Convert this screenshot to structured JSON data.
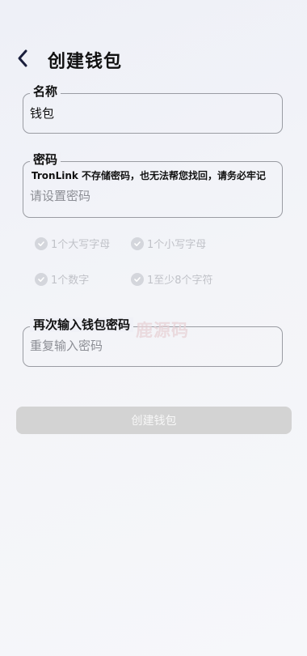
{
  "header": {
    "back_icon": "chevron-left-icon",
    "title": "创建钱包"
  },
  "wallet_name": {
    "label": "名称",
    "value": "钱包"
  },
  "password": {
    "label": "密码",
    "hint": "TronLink 不存储密码，也无法帮您找回，请务必牢记",
    "placeholder": "请设置密码"
  },
  "rules": [
    {
      "label": "1个大写字母",
      "icon": "check-circle-icon"
    },
    {
      "label": "1个小写字母",
      "icon": "check-circle-icon"
    },
    {
      "label": "1个数字",
      "icon": "check-circle-icon"
    },
    {
      "label": "1至少8个字符",
      "icon": "check-circle-icon"
    }
  ],
  "confirm_password": {
    "label": "再次输入钱包密码",
    "placeholder": "重复输入密码"
  },
  "watermark": "鹿源码",
  "create_button": {
    "label": "创建钱包"
  },
  "colors": {
    "button_disabled": "#d3d3d3",
    "rule_inactive": "#c0c2c8"
  }
}
